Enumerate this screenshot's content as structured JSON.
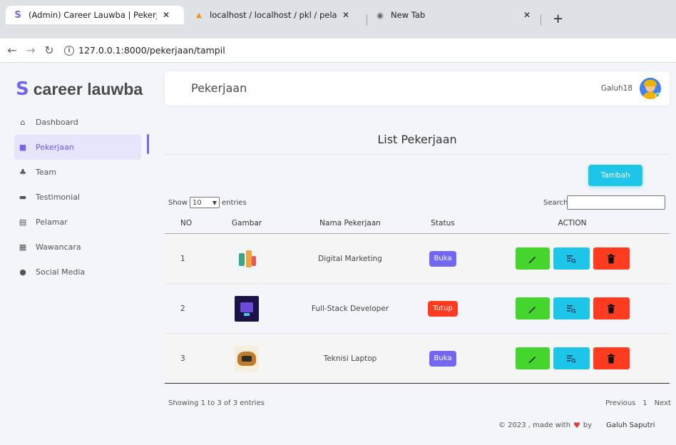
{
  "browser": {
    "tabs": [
      {
        "title": "(Admin) Career Lauwba | Pekerja",
        "favicon": "s-logo-icon",
        "active": true
      },
      {
        "title": "localhost / localhost / pkl / pelam",
        "favicon": "phpmyadmin-icon",
        "active": false
      },
      {
        "title": "New Tab",
        "favicon": "globe-icon",
        "active": false
      }
    ],
    "url": "127.0.0.1:8000/pekerjaan/tampil"
  },
  "sidebar": {
    "brand": "career lauwba",
    "items": [
      {
        "label": "Dashboard",
        "icon": "home-icon"
      },
      {
        "label": "Pekerjaan",
        "icon": "briefcase-icon",
        "active": true
      },
      {
        "label": "Team",
        "icon": "users-icon"
      },
      {
        "label": "Testimonial",
        "icon": "message-icon"
      },
      {
        "label": "Pelamar",
        "icon": "id-card-icon"
      },
      {
        "label": "Wawancara",
        "icon": "calendar-icon"
      },
      {
        "label": "Social Media",
        "icon": "chat-icon"
      }
    ]
  },
  "header": {
    "title": "Pekerjaan",
    "username": "Galuh18"
  },
  "main": {
    "list_title": "List Pekerjaan",
    "add_button": "Tambah",
    "show_label": "Show",
    "entries_value": "10",
    "entries_label": "entries",
    "search_label": "Search:",
    "columns": [
      "NO",
      "Gambar",
      "Nama Pekerjaan",
      "Status",
      "ACTION"
    ],
    "rows": [
      {
        "no": "1",
        "name": "Digital Marketing",
        "status": "Buka"
      },
      {
        "no": "2",
        "name": "Full-Stack Developer",
        "status": "Tutup"
      },
      {
        "no": "3",
        "name": "Teknisi Laptop",
        "status": "Buka"
      }
    ],
    "info": "Showing 1 to 3 of 3 entries",
    "pager": {
      "prev": "Previous",
      "page": "1",
      "next": "Next"
    }
  },
  "footer": {
    "copyright": "© 2023 , made with",
    "by": "by",
    "author": "Galuh Saputri"
  },
  "colors": {
    "accent": "#7367f0",
    "status_open": "#7367f0",
    "status_closed": "#ff3b1f",
    "edit": "#44d62c",
    "detail": "#1dc6e9",
    "delete": "#ff3b1f"
  }
}
